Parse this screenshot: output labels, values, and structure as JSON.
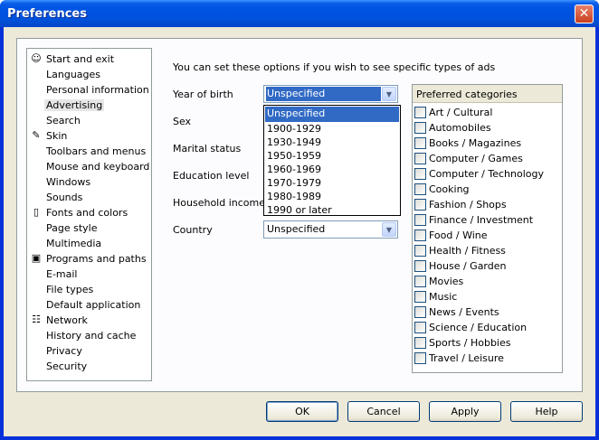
{
  "window": {
    "title": "Preferences"
  },
  "sidebar": {
    "items": [
      {
        "label": "Start and exit",
        "icon": "person-icon"
      },
      {
        "label": "Languages"
      },
      {
        "label": "Personal information"
      },
      {
        "label": "Advertising",
        "selected": true
      },
      {
        "label": "Search"
      },
      {
        "label": "Skin",
        "icon": "paint-icon"
      },
      {
        "label": "Toolbars and menus"
      },
      {
        "label": "Mouse and keyboard"
      },
      {
        "label": "Windows"
      },
      {
        "label": "Sounds"
      },
      {
        "label": "Fonts and colors",
        "icon": "document-icon"
      },
      {
        "label": "Page style"
      },
      {
        "label": "Multimedia"
      },
      {
        "label": "Programs and paths",
        "icon": "disk-icon"
      },
      {
        "label": "E-mail"
      },
      {
        "label": "File types"
      },
      {
        "label": "Default application"
      },
      {
        "label": "Network",
        "icon": "network-icon"
      },
      {
        "label": "History and cache"
      },
      {
        "label": "Privacy"
      },
      {
        "label": "Security"
      }
    ]
  },
  "main": {
    "intro": "You can set these options if you wish to see specific types of ads",
    "fields": {
      "year_of_birth": {
        "label": "Year of birth",
        "value": "Unspecified"
      },
      "sex": {
        "label": "Sex"
      },
      "marital_status": {
        "label": "Marital status"
      },
      "education_level": {
        "label": "Education level"
      },
      "household_income": {
        "label": "Household income"
      },
      "country": {
        "label": "Country",
        "value": "Unspecified"
      }
    },
    "year_dropdown": {
      "options": [
        "Unspecified",
        "1900-1929",
        "1930-1949",
        "1950-1959",
        "1960-1969",
        "1970-1979",
        "1980-1989",
        "1990 or later"
      ],
      "highlighted": "Unspecified"
    },
    "categories": {
      "header": "Preferred categories",
      "items": [
        "Art / Cultural",
        "Automobiles",
        "Books / Magazines",
        "Computer / Games",
        "Computer / Technology",
        "Cooking",
        "Fashion / Shops",
        "Finance / Investment",
        "Food / Wine",
        "Health / Fitness",
        "House / Garden",
        "Movies",
        "Music",
        "News / Events",
        "Science / Education",
        "Sports / Hobbies",
        "Travel / Leisure"
      ]
    }
  },
  "buttons": {
    "ok": "OK",
    "cancel": "Cancel",
    "apply": "Apply",
    "help": "Help"
  },
  "colors": {
    "title_bar": "#0054e3",
    "selection": "#316ac5",
    "dialog_bg": "#ece9d8"
  }
}
